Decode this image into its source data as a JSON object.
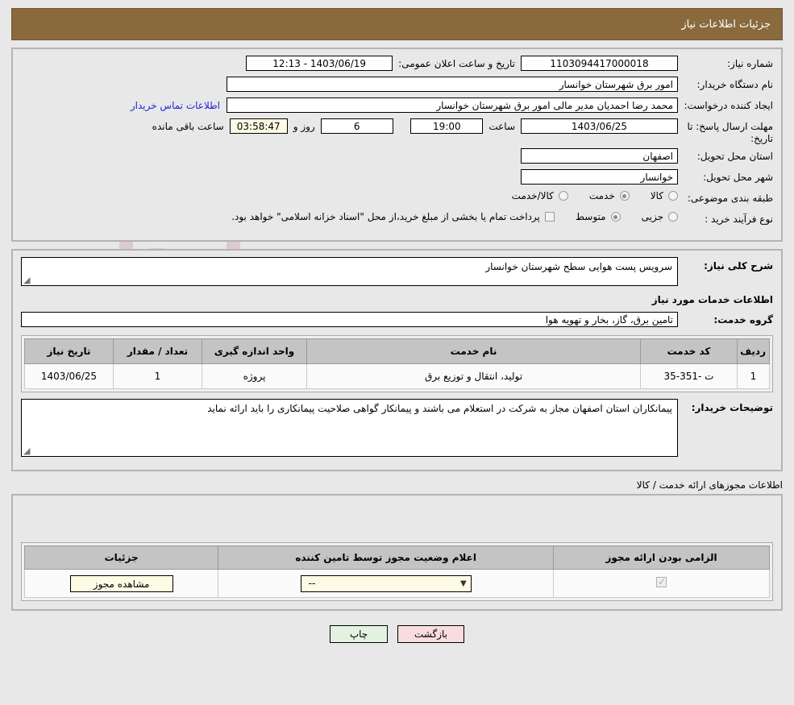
{
  "header": {
    "title": "جزئیات اطلاعات نیاز"
  },
  "form": {
    "need_number_label": "شماره نیاز:",
    "need_number_value": "1103094417000018",
    "public_announce_label": "تاریخ و ساعت اعلان عمومی:",
    "public_announce_value": "1403/06/19 - 12:13",
    "buyer_org_label": "نام دستگاه خریدار:",
    "buyer_org_value": "امور برق شهرستان خوانسار",
    "creator_label": "ایجاد کننده درخواست:",
    "creator_value": "محمد رضا احمدیان مدیر مالی امور برق شهرستان خوانسار",
    "contact_link": "اطلاعات تماس خریدار",
    "deadline_label": "مهلت ارسال پاسخ: تا تاریخ:",
    "deadline_date": "1403/06/25",
    "hour_label": "ساعت",
    "deadline_time": "19:00",
    "days_value": "6",
    "days_label": "روز و",
    "countdown": "03:58:47",
    "remaining_label": "ساعت باقی مانده",
    "province_label": "استان محل تحویل:",
    "province_value": "اصفهان",
    "city_label": "شهر محل تحویل:",
    "city_value": "خوانسار",
    "category_label": "طبقه بندی موضوعی:",
    "category_options": [
      {
        "label": "کالا",
        "selected": false
      },
      {
        "label": "خدمت",
        "selected": true
      },
      {
        "label": "کالا/خدمت",
        "selected": false
      }
    ],
    "process_label": "نوع فرآیند خرید :",
    "process_options": [
      {
        "label": "جزیی",
        "selected": false
      },
      {
        "label": "متوسط",
        "selected": true
      }
    ],
    "treasury_note": "پرداخت تمام یا بخشی از مبلغ خرید،از محل \"اسناد خزانه اسلامی\" خواهد بود."
  },
  "description": {
    "general_label": "شرح کلی نیاز:",
    "general_value": "سرویس پست هوایی سطح شهرستان خوانسار",
    "services_section_title": "اطلاعات خدمات مورد نیاز",
    "service_group_label": "گروه خدمت:",
    "service_group_value": "تامین برق، گاز، بخار و تهویه هوا"
  },
  "services_table": {
    "columns": [
      "ردیف",
      "کد خدمت",
      "نام خدمت",
      "واحد اندازه گیری",
      "تعداد / مقدار",
      "تاریخ نیاز"
    ],
    "rows": [
      {
        "row": "1",
        "code": "ت -351-35",
        "name": "تولید، انتقال و توزیع برق",
        "unit": "پروژه",
        "quantity": "1",
        "need_date": "1403/06/25"
      }
    ]
  },
  "buyer_notes": {
    "label": "توضیحات خریدار:",
    "value": "پیمانکاران استان اصفهان مجاز به شرکت در استعلام می باشند و پیمانکار گواهی صلاحیت پیمانکاری را باید ارائه نماید"
  },
  "permits": {
    "caption": "اطلاعات مجوزهای ارائه خدمت / کالا",
    "columns": [
      "الزامی بودن ارائه مجوز",
      "اعلام وضعیت مجوز توسط تامین کننده",
      "جزئیات"
    ],
    "rows": [
      {
        "required": true,
        "status_value": "--",
        "details_button": "مشاهده مجوز"
      }
    ]
  },
  "footer": {
    "print_label": "چاپ",
    "back_label": "بازگشت"
  },
  "colors": {
    "header_bg": "#8a6a3d",
    "link": "#2222dd",
    "print_btn": "#e3f2e1",
    "back_btn": "#fadcdc",
    "highlight_field": "#fdfbe4"
  }
}
